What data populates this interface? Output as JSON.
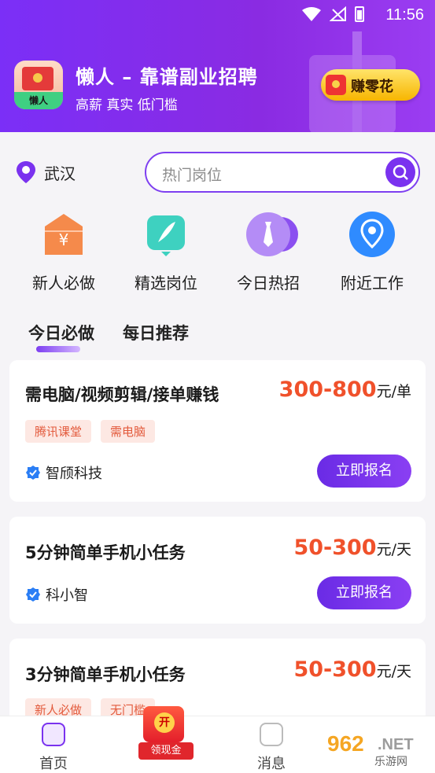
{
  "status": {
    "time": "11:56"
  },
  "header": {
    "title": "懒人 – 靠谱副业招聘",
    "subtitle": "高薪 真实 低门槛",
    "logo_label": "懒人",
    "earn_label": "赚零花"
  },
  "search": {
    "location": "武汉",
    "placeholder": "热门岗位"
  },
  "categories": [
    {
      "label": "新人必做",
      "icon": "coupon-icon",
      "color": "#f58a4b"
    },
    {
      "label": "精选岗位",
      "icon": "feather-icon",
      "color": "#3ed1c0"
    },
    {
      "label": "今日热招",
      "icon": "tie-icon",
      "color": "#a374f2"
    },
    {
      "label": "附近工作",
      "icon": "location-icon",
      "color": "#2f8bff"
    }
  ],
  "tabs": [
    {
      "label": "今日必做",
      "active": true
    },
    {
      "label": "每日推荐",
      "active": false
    }
  ],
  "jobs": [
    {
      "title": "需电脑/视频剪辑/接单赚钱",
      "salary": "300-800",
      "unit": "元/单",
      "tags": [
        "腾讯课堂",
        "需电脑"
      ],
      "company": "智颀科技",
      "button": "立即报名"
    },
    {
      "title": "5分钟简单手机小任务",
      "salary": "50-300",
      "unit": "元/天",
      "tags": [],
      "company": "科小智",
      "button": "立即报名"
    },
    {
      "title": "3分钟简单手机小任务",
      "salary": "50-300",
      "unit": "元/天",
      "tags": [
        "新人必做",
        "无门槛"
      ],
      "company": "",
      "button": ""
    }
  ],
  "bottom_nav": [
    {
      "label": "首页",
      "icon": "home-icon"
    },
    {
      "label": "领现金",
      "icon": "red-packet-icon",
      "badge": "开"
    },
    {
      "label": "消息",
      "icon": "message-icon"
    }
  ],
  "watermark": {
    "num": "962",
    "net": ".NET",
    "sub": "乐游网"
  },
  "colors": {
    "brand": "#7b2ff7",
    "salary": "#f0512b",
    "button": "#6a2be5"
  }
}
